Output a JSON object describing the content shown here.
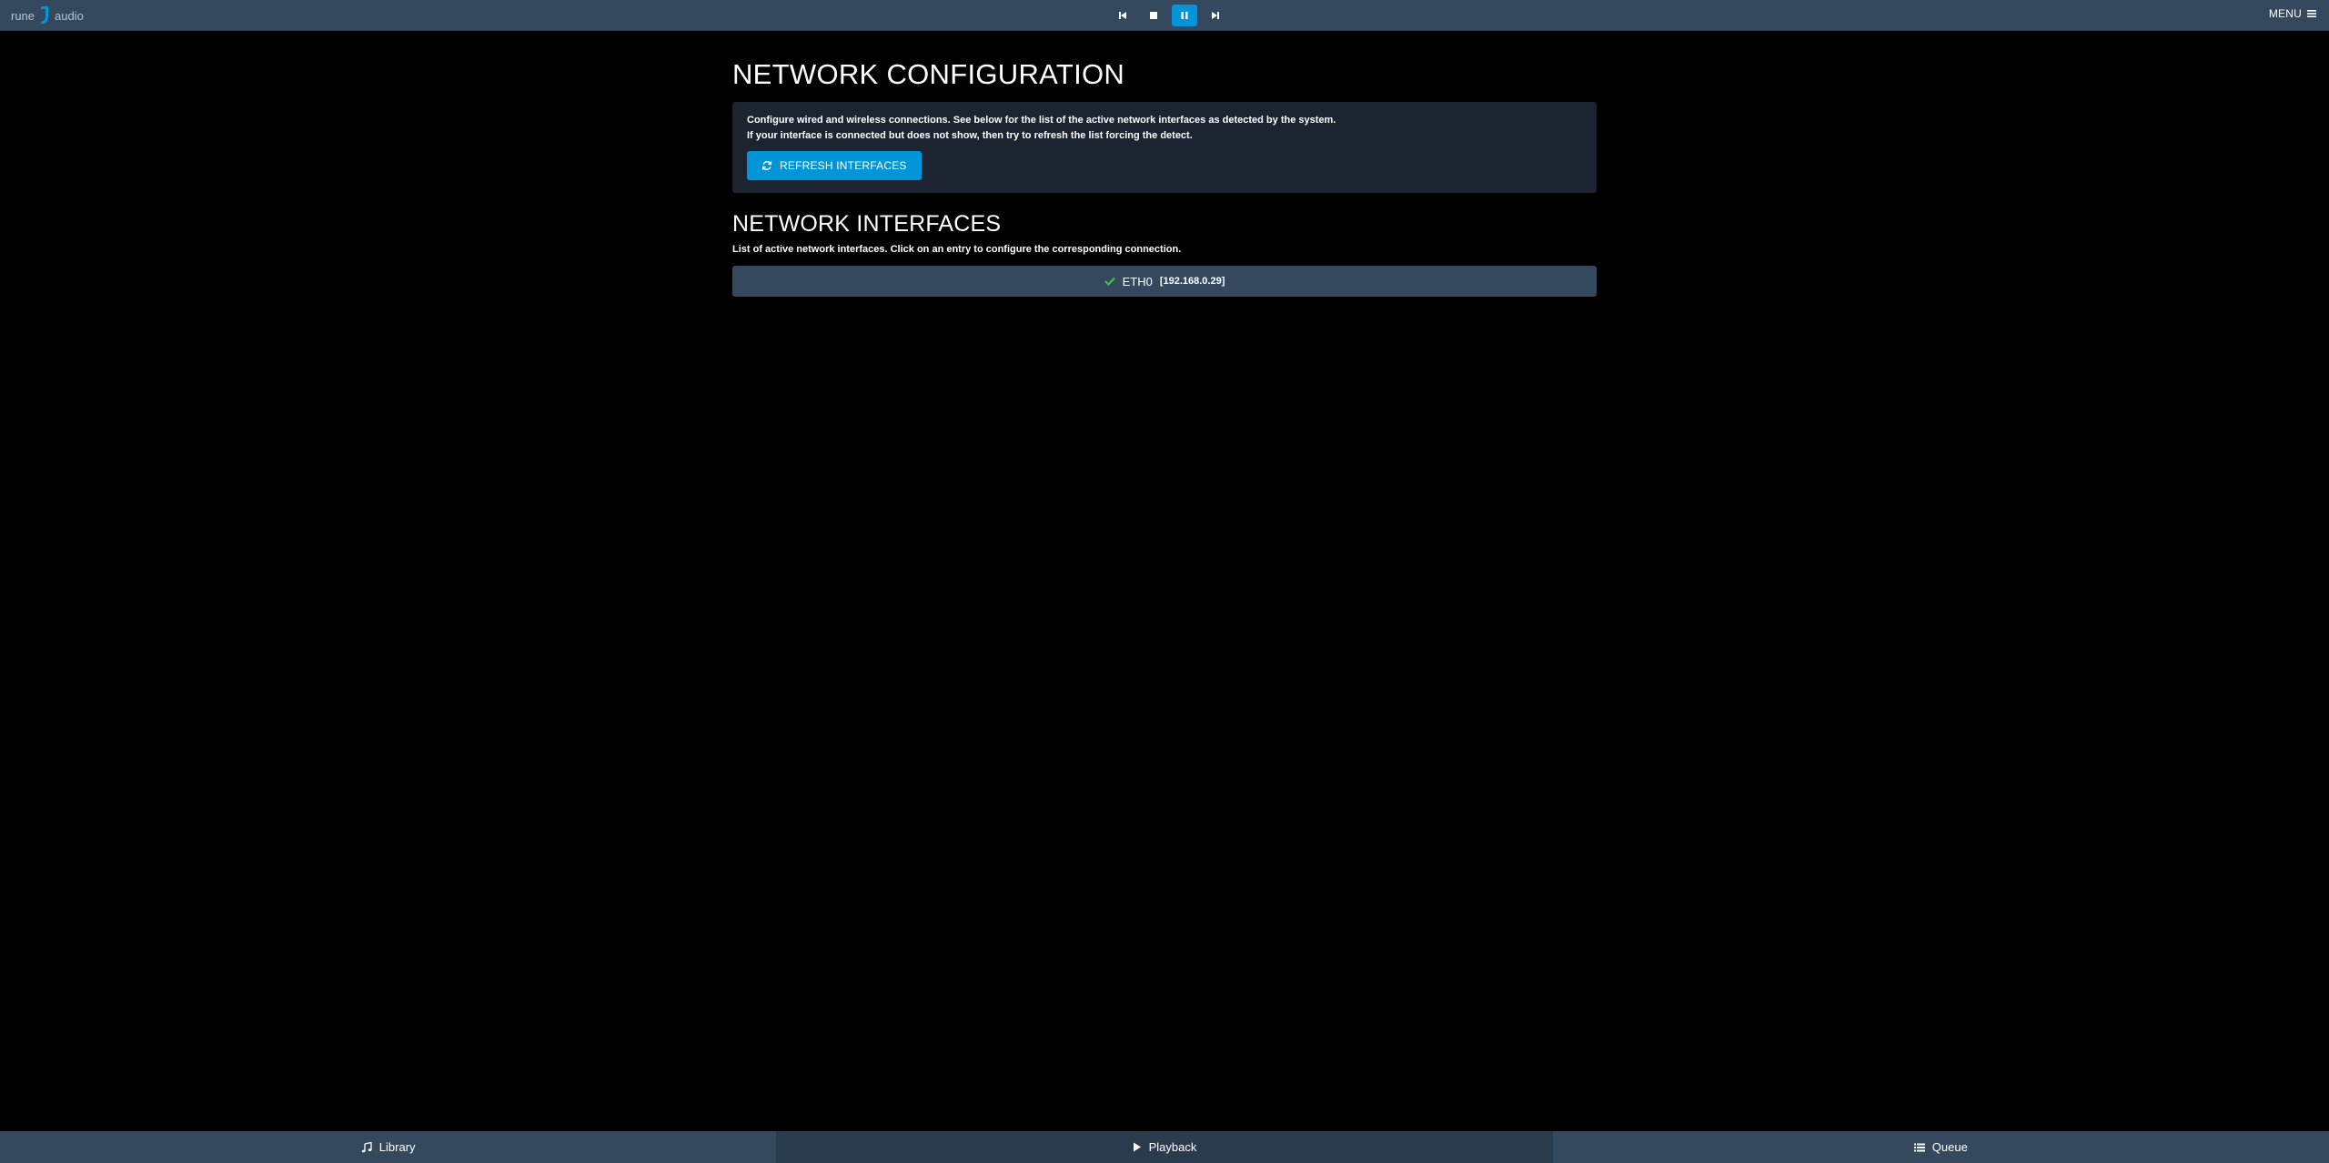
{
  "topbar": {
    "logo_left": "rune",
    "logo_right": "audio",
    "logo_icon": "rune-logo-icon",
    "transport": [
      {
        "name": "previous",
        "icon": "step-backward-icon",
        "active": false
      },
      {
        "name": "stop",
        "icon": "stop-icon",
        "active": false
      },
      {
        "name": "pause",
        "icon": "pause-icon",
        "active": true
      },
      {
        "name": "next",
        "icon": "step-forward-icon",
        "active": false
      }
    ],
    "menu_label": "MENU",
    "accent": "#0095d8",
    "bar_color": "#34495e"
  },
  "main": {
    "title": "NETWORK CONFIGURATION",
    "info_line1": "Configure wired and wireless connections. See below for the list of the active network interfaces as detected by the system.",
    "info_line2": "If your interface is connected but does not show, then try to refresh the list forcing the detect.",
    "refresh_label": "REFRESH INTERFACES",
    "interfaces_title": "NETWORK INTERFACES",
    "interfaces_desc": "List of active network interfaces. Click on an entry to configure the corresponding connection.",
    "interfaces": [
      {
        "name": "ETH0",
        "ip": "[192.168.0.29]",
        "status_icon": "check-icon",
        "status_color": "#2ecc40"
      }
    ]
  },
  "bottombar": {
    "tabs": [
      {
        "label": "Library",
        "icon": "music-note-icon",
        "active": false
      },
      {
        "label": "Playback",
        "icon": "play-icon",
        "active": true
      },
      {
        "label": "Queue",
        "icon": "list-icon",
        "active": false
      }
    ]
  }
}
